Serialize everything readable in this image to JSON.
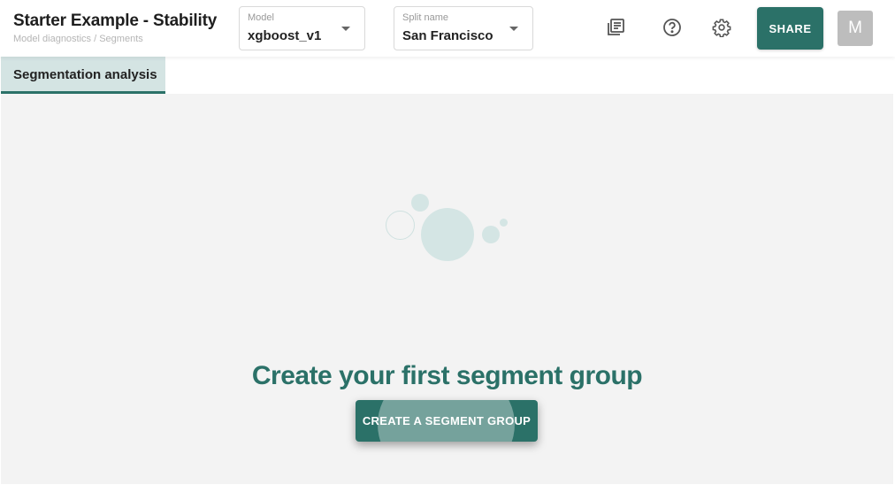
{
  "header": {
    "title": "Starter Example - Stability",
    "breadcrumb": "Model diagnostics / Segments",
    "model_select": {
      "label": "Model",
      "value": "xgboost_v1"
    },
    "split_select": {
      "label": "Split name",
      "value": "San Francisco"
    },
    "icons": [
      "report-icon",
      "help-icon",
      "settings-icon"
    ],
    "share_label": "SHARE",
    "avatar_initial": "M"
  },
  "tabs": [
    {
      "label": "Segmentation analysis",
      "active": true
    }
  ],
  "empty_state": {
    "heading": "Create your first segment group",
    "button_label": "CREATE A SEGMENT GROUP"
  },
  "colors": {
    "accent": "#2b7168",
    "tab_active_bg": "#d4e4e3",
    "bubble": "#d4e5e4",
    "background": "#f3f3f3"
  }
}
